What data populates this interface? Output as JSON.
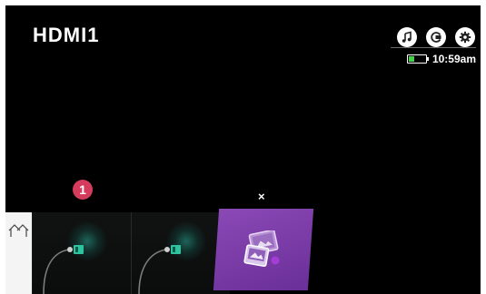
{
  "screen": {
    "input_name": "HDMI1",
    "time": "10:59am",
    "battery_level": 0.35
  },
  "top_icons": [
    {
      "name": "music-icon"
    },
    {
      "name": "cast-icon"
    },
    {
      "name": "gear-icon"
    }
  ],
  "launcher": {
    "badge_number": "1",
    "close_symbol": "×",
    "tiles": [
      {
        "name": "home-tile",
        "icon": "home-icon"
      },
      {
        "name": "hdmi-input-tile-1",
        "icon": "hdmi-cable-icon"
      },
      {
        "name": "hdmi-input-tile-2",
        "icon": "hdmi-cable-icon"
      },
      {
        "name": "photo-video-tile",
        "icon": "photo-video-icon"
      }
    ]
  },
  "colors": {
    "background": "#000000",
    "badge": "#d43b5d",
    "photo_tile": "#7a3da8",
    "battery_fill": "#48d04a",
    "connector": "#2ec4a0"
  }
}
